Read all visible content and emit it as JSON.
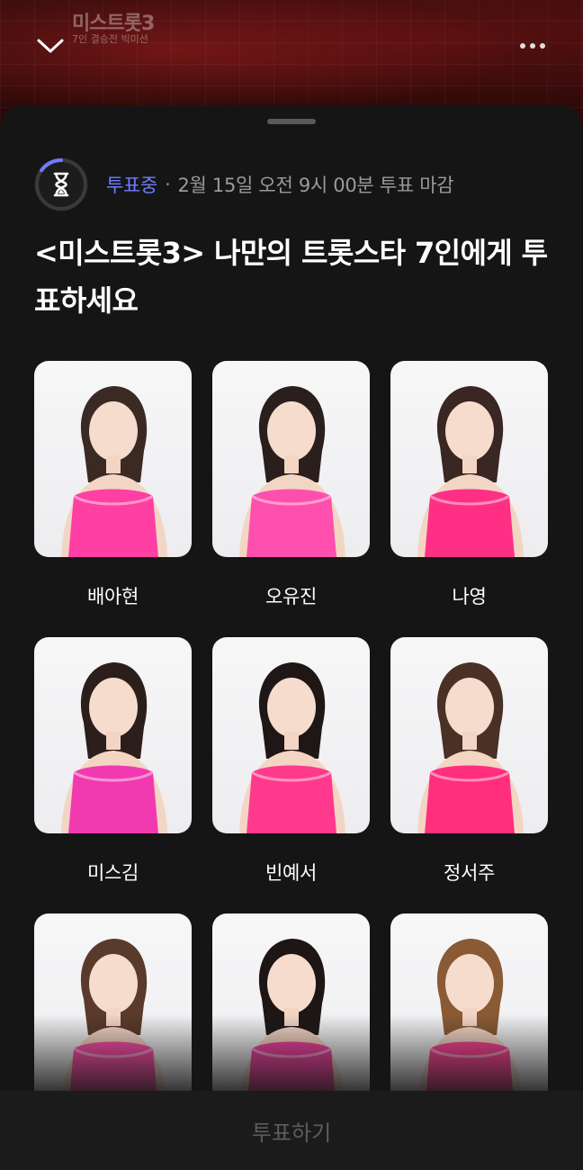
{
  "banner": {
    "logo_text": "미스트롯3",
    "badge_text": "7인 결승전 빅미션"
  },
  "status": {
    "live_label": "투표중",
    "separator": "·",
    "deadline": "2월 15일 오전 9시 00분 투표 마감",
    "accent_color": "#6f7dff"
  },
  "title": "<미스트롯3> 나만의 트롯스타 7인에게 투표하세요",
  "candidates": [
    {
      "name": "배아현",
      "outfit": "#ff3fa3"
    },
    {
      "name": "오유진",
      "outfit": "#ff4fae"
    },
    {
      "name": "나영",
      "outfit": "#ff2f86"
    },
    {
      "name": "미스김",
      "outfit": "#f23ab0"
    },
    {
      "name": "빈예서",
      "outfit": "#ff3a8c"
    },
    {
      "name": "정서주",
      "outfit": "#ff2f7d"
    },
    {
      "name": "",
      "outfit": "#ff4aa8"
    },
    {
      "name": "",
      "outfit": "#f43ea0"
    },
    {
      "name": "",
      "outfit": "#ff3f93"
    }
  ],
  "footer": {
    "vote_label": "투표하기"
  }
}
